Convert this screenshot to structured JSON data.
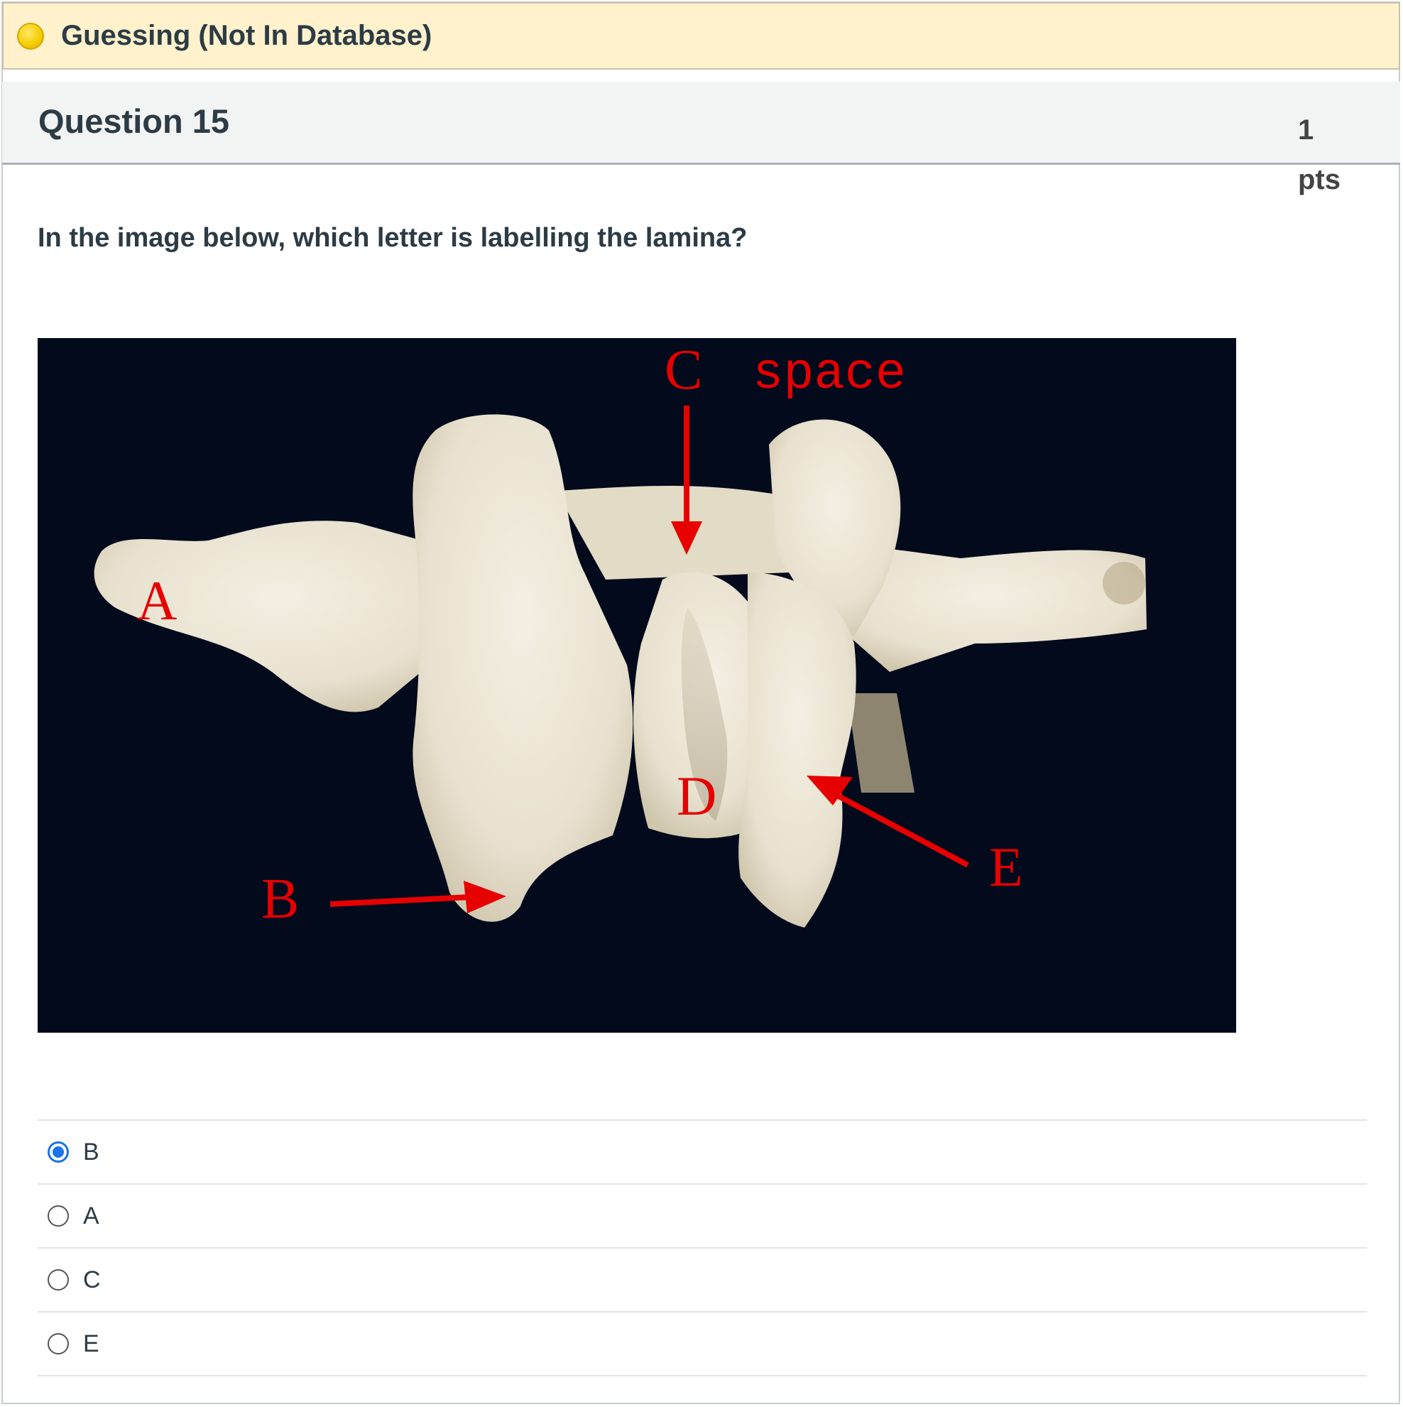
{
  "status_bar": {
    "icon": "yellow-circle-icon",
    "text": "Guessing (Not In Database)"
  },
  "question": {
    "title": "Question 15",
    "points_value": "1",
    "points_unit": "pts",
    "text": "In the image below, which letter is labelling the lamina?"
  },
  "figure": {
    "description_icon": "vertebra-photo",
    "labels": {
      "a": "A",
      "b": "B",
      "c": "C",
      "d": "D",
      "e": "E",
      "space": "space"
    },
    "label_color": "#e60000"
  },
  "answers": [
    {
      "label": "B",
      "selected": true
    },
    {
      "label": "A",
      "selected": false
    },
    {
      "label": "C",
      "selected": false
    },
    {
      "label": "E",
      "selected": false
    }
  ],
  "colors": {
    "status_bg": "#fff2cc",
    "header_bg": "#f2f4f4",
    "selected_radio": "#1a73e8"
  }
}
